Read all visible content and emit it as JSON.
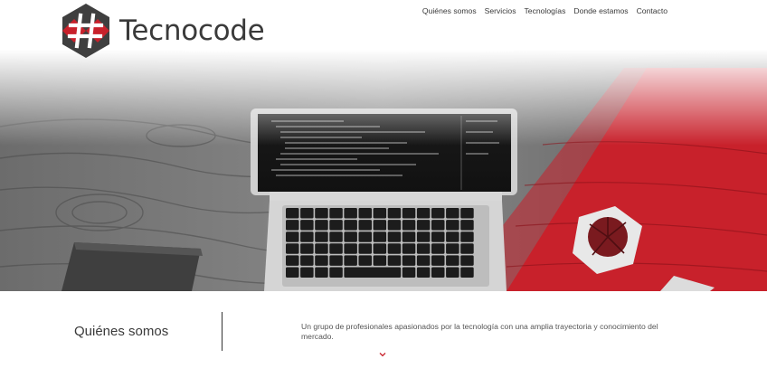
{
  "brand": {
    "name": "Tecnocode",
    "logo_symbol": "#"
  },
  "nav": [
    {
      "label": "Quiénes somos"
    },
    {
      "label": "Servicios"
    },
    {
      "label": "Tecnologías"
    },
    {
      "label": "Donde estamos"
    },
    {
      "label": "Contacto"
    }
  ],
  "about": {
    "title": "Quiénes somos",
    "text": "Un grupo de profesionales apasionados por la tecnología con una amplia trayectoria y conocimiento del mercado."
  },
  "colors": {
    "accent": "#c8212b",
    "dark": "#3a3a3a"
  },
  "icons": {
    "scroll": "chevron-down-icon"
  }
}
